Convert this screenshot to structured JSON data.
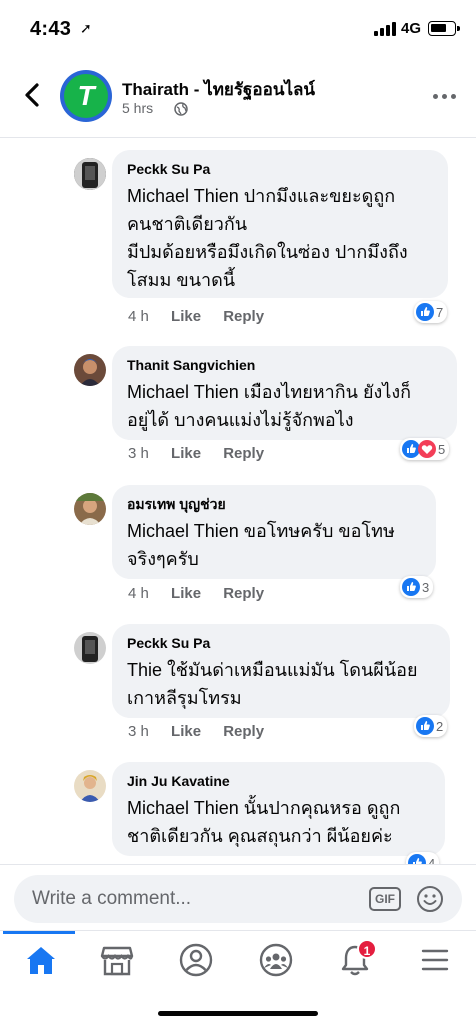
{
  "status_bar": {
    "time": "4:43",
    "location_glyph": "➚",
    "network": "4G",
    "icon_names": [
      "signal-icon",
      "battery-icon"
    ]
  },
  "header": {
    "title": "Thairath - ไทยรัฐออนไลน์",
    "time": "5 hrs",
    "avatar_letter": "T",
    "icons": [
      "back-arrow-icon",
      "globe-icon",
      "more-icon"
    ]
  },
  "comments": [
    {
      "author": "Peckk Su Pa",
      "text": "Michael Thien ปากมึงและขยะดูถูก\nคนชาติเดียวกัน\nมีปมด้อยหรือมึงเกิดในซ่อง ปากมึงถึง\nโสมม ขนาดนี้",
      "time": "4 h",
      "like": "Like",
      "reply": "Reply",
      "reaction_count": "7"
    },
    {
      "author": "Thanit Sangvichien",
      "text": "Michael Thien เมืองไทยหากิน ยังไงก็\nอยู่ได้ บางคนแม่งไม่รู้จักพอไง",
      "time": "3 h",
      "like": "Like",
      "reply": "Reply",
      "reaction_count": "5"
    },
    {
      "author": "อมรเทพ บุญช่วย",
      "text": "Michael Thien ขอโทษครับ ขอโทษ\nจริงๆครับ",
      "time": "4 h",
      "like": "Like",
      "reply": "Reply",
      "reaction_count": "3"
    },
    {
      "author": "Peckk Su Pa",
      "text": "Thie ใช้มันด่าเหมือนแม่มัน โดนผีน้อย\nเกาหลีรุมโทรม",
      "time": "3 h",
      "like": "Like",
      "reply": "Reply",
      "reaction_count": "2"
    },
    {
      "author": "Jin Ju Kavatine",
      "text": "Michael Thien นั้นปากคุณหรอ ดูถูก\nชาติเดียวกัน คุณสถุนกว่า ผีน้อยค่ะ",
      "time": "",
      "like": "",
      "reply": "",
      "reaction_count": "4"
    }
  ],
  "composer": {
    "placeholder": "Write a comment...",
    "gif_label": "GIF"
  },
  "tabbar": {
    "notifications_badge": "1",
    "tabs": [
      "home-icon",
      "marketplace-icon",
      "profile-icon",
      "groups-icon",
      "notifications-icon",
      "menu-icon"
    ]
  },
  "colors": {
    "accent": "#1877f2",
    "bubble": "#f0f2f5",
    "secondary_text": "#65676b",
    "badge": "#e41e3f",
    "love": "#f33e58"
  }
}
